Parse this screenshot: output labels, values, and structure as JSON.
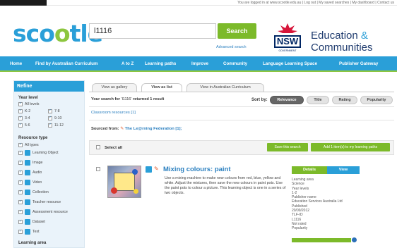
{
  "topbar": {
    "text": "You are logged in at www.scootle.edu.au  |  Log out  |  My saved searches  |  My dashboard  |  Contact us"
  },
  "header": {
    "logo": {
      "part1": "sc",
      "o1": "o",
      "o2": "o",
      "part2": "tle"
    },
    "search_value": "l1116",
    "search_button": "Search",
    "advanced_search": "Advanced search",
    "nsw_text": "NSW",
    "nsw_government": "GOVERNMENT",
    "education_line1": "Education",
    "education_amp": "&",
    "education_line2": "Communities"
  },
  "nav": {
    "items": [
      "Home",
      "Find by Australian Curriculum",
      "A to Z",
      "Learning paths",
      "Improve",
      "Community",
      "Language Learning Space",
      "Publisher Gateway"
    ]
  },
  "sidebar": {
    "refine": "Refine",
    "year_level_title": "Year level",
    "year_levels": [
      "All levels",
      "K-2",
      "7-8",
      "3-4",
      "9-10",
      "5-6",
      "11-12"
    ],
    "resource_type_title": "Resource type",
    "resource_types": [
      "All types",
      "Learning Object",
      "Image",
      "Audio",
      "Video",
      "Collection",
      "Teacher resource",
      "Assessment resource",
      "Dataset",
      "Text"
    ],
    "learning_area_title": "Learning area"
  },
  "views": {
    "tabs": [
      "View as gallery",
      "View as list",
      "View in Australian Curriculum"
    ],
    "active_index": 1
  },
  "results": {
    "summary_prefix": "Your search for",
    "query": "'l1116'",
    "summary_suffix": "returned 1 result",
    "sort_label": "Sort by:",
    "sort_options": [
      "Relevance",
      "Title",
      "Rating",
      "Popularity"
    ],
    "sort_active": "Relevance",
    "classroom_link": "Classroom resources [1]",
    "sourced_label": "Sourced from:",
    "sourced_value": "The Le@rning Federation [1];",
    "select_all": "Select all",
    "save_search": "Save this search",
    "add_to_path": "Add 1 item(s) to my learning paths"
  },
  "item": {
    "title": "Mixing colours: paint",
    "description": "Use a mixing machine to make new colours from red, blue, yellow and white. Adjust the mixtures, then save the new colours in paint pots. Use the paint pots to colour a picture. This learning object is one in a series of two objects.",
    "details_label": "Details",
    "view_label": "View",
    "meta": [
      "Learning area",
      "Science",
      "Year levels",
      "1-2",
      "Publisher name",
      "Education Services Australia Ltd",
      "Published",
      "20/09/2012",
      "TLF-ID",
      "L1116",
      "Not rated",
      "Popularity"
    ]
  },
  "colors": {
    "brand_blue": "#2a9fd8",
    "brand_green": "#7cba2a",
    "nsw_navy": "#002664"
  }
}
